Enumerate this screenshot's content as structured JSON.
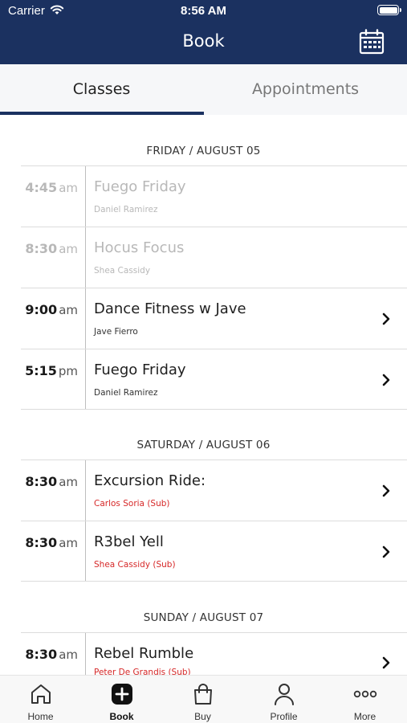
{
  "status_bar": {
    "carrier": "Carrier",
    "time": "8:56 AM"
  },
  "header": {
    "title": "Book",
    "calendar_icon": "calendar-icon"
  },
  "tabs": [
    {
      "label": "Classes",
      "active": true
    },
    {
      "label": "Appointments",
      "active": false
    }
  ],
  "days": [
    {
      "header": "FRIDAY / AUGUST 05",
      "classes": [
        {
          "time": "4:45",
          "ampm": "am",
          "name": "Fuego Friday",
          "instructor": "Daniel Ramirez",
          "past": true,
          "sub": false
        },
        {
          "time": "8:30",
          "ampm": "am",
          "name": "Hocus Focus",
          "instructor": "Shea Cassidy",
          "past": true,
          "sub": false
        },
        {
          "time": "9:00",
          "ampm": "am",
          "name": "Dance Fitness w Jave",
          "instructor": "Jave Fierro",
          "past": false,
          "sub": false
        },
        {
          "time": "5:15",
          "ampm": "pm",
          "name": "Fuego Friday",
          "instructor": "Daniel Ramirez",
          "past": false,
          "sub": false
        }
      ]
    },
    {
      "header": "SATURDAY / AUGUST 06",
      "classes": [
        {
          "time": "8:30",
          "ampm": "am",
          "name": "Excursion Ride:",
          "instructor": "Carlos Soria (Sub)",
          "past": false,
          "sub": true
        },
        {
          "time": "8:30",
          "ampm": "am",
          "name": "R3bel Yell",
          "instructor": "Shea Cassidy (Sub)",
          "past": false,
          "sub": true
        }
      ]
    },
    {
      "header": "SUNDAY / AUGUST 07",
      "classes": [
        {
          "time": "8:30",
          "ampm": "am",
          "name": "Rebel Rumble",
          "instructor": "Peter De Grandis (Sub)",
          "past": false,
          "sub": true
        }
      ]
    }
  ],
  "tabbar": [
    {
      "label": "Home",
      "icon": "home-icon",
      "active": false
    },
    {
      "label": "Book",
      "icon": "plus-square-icon",
      "active": true
    },
    {
      "label": "Buy",
      "icon": "shopping-bag-icon",
      "active": false
    },
    {
      "label": "Profile",
      "icon": "person-icon",
      "active": false
    },
    {
      "label": "More",
      "icon": "ellipsis-icon",
      "active": false
    }
  ],
  "colors": {
    "header_bg": "#1b3160",
    "sub_instructor": "#d62828",
    "past_text": "#b8b8b8"
  }
}
